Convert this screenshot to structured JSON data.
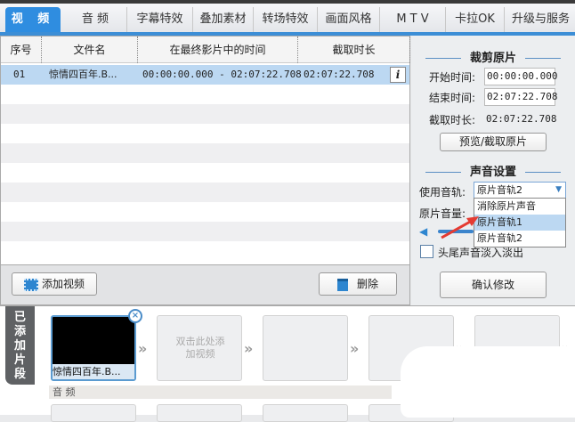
{
  "tabs": [
    "视 频",
    "音 频",
    "字幕特效",
    "叠加素材",
    "转场特效",
    "画面风格",
    "M T V",
    "卡拉OK",
    "升级与服务"
  ],
  "table": {
    "headers": [
      "序号",
      "文件名",
      "在最终影片中的时间",
      "截取时长"
    ],
    "rows": [
      {
        "index": "01",
        "filename": "惊情四百年.B...",
        "time_range": "00:00:00.000 - 02:07:22.708",
        "duration": "02:07:22.708",
        "info": "i"
      }
    ]
  },
  "buttons": {
    "add_video": "添加视频",
    "delete": "删除",
    "confirm": "确认修改",
    "preview": "预览/截取原片"
  },
  "trim": {
    "title": "裁剪原片",
    "start_label": "开始时间:",
    "start": "00:00:00.000",
    "end_label": "结束时间:",
    "end": "02:07:22.708",
    "dur_label": "截取时长:",
    "dur": "02:07:22.708"
  },
  "audio": {
    "title": "声音设置",
    "track_label": "使用音轨:",
    "track": "原片音轨2",
    "options": [
      "消除原片声音",
      "原片音轨1",
      "原片音轨2"
    ],
    "volume_label": "原片音量:",
    "fade_label": "头尾声音淡入淡出",
    "fade_checked": false
  },
  "clips": {
    "side_tab": "已添加片段",
    "clip_name": "惊情四百年.B...",
    "placeholder": "双击此处添加视频",
    "audio_label": "音 频"
  }
}
